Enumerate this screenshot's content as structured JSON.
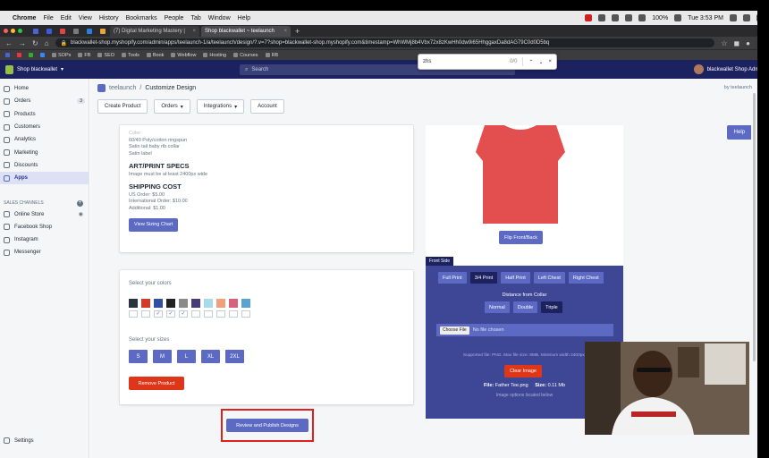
{
  "menubar": {
    "app": "Chrome",
    "items": [
      "File",
      "Edit",
      "View",
      "History",
      "Bookmarks",
      "People",
      "Tab",
      "Window",
      "Help"
    ],
    "battery": "100%",
    "clock": "Tue 3:53 PM"
  },
  "tabs": [
    {
      "label": "(7) Digital Marketing Mastery |",
      "active": false
    },
    {
      "label": "Shop blackwallet ~ teelaunch",
      "active": true
    }
  ],
  "address": {
    "url": "blackwallet-shop.myshopify.com/admin/apps/teelaunch-1/a/teelaunch/design/?.v=7?shop=blackwallet-shop.myshopify.com&timestamp=WhWMj8b4Vbx72x8zKwHh0dw9i65HhggaxDa8dAG79C0d0D5bq"
  },
  "bookmarks": [
    "SOPs",
    "FB",
    "SEO",
    "Tools",
    "Book",
    "Webflow",
    "Hosting",
    "Courses",
    "RB"
  ],
  "find": {
    "query": "zhs",
    "count": "0/0"
  },
  "shopbar": {
    "store": "Shop blackwallet",
    "search_placeholder": "Search",
    "admin": "blackwallet Shop Admin"
  },
  "sidebar": {
    "items": [
      {
        "label": "Home"
      },
      {
        "label": "Orders",
        "badge": "3"
      },
      {
        "label": "Products"
      },
      {
        "label": "Customers"
      },
      {
        "label": "Analytics"
      },
      {
        "label": "Marketing"
      },
      {
        "label": "Discounts"
      },
      {
        "label": "Apps"
      }
    ],
    "channels_label": "SALES CHANNELS",
    "channels": [
      {
        "label": "Online Store"
      },
      {
        "label": "Facebook Shop"
      },
      {
        "label": "Instagram"
      },
      {
        "label": "Messenger"
      }
    ],
    "settings": "Settings"
  },
  "header": {
    "app_name": "teelaunch",
    "separator": "/",
    "page_title": "Customize Design",
    "by": "by teelaunch"
  },
  "toolbar": {
    "create": "Create Product",
    "orders": "Orders",
    "integrations": "Integrations",
    "account": "Account",
    "help": "Help"
  },
  "specs": {
    "cut_line": "Color:",
    "lines": [
      "60/40 Poly/cotton ringspun",
      "Satin tail baby rib collar",
      "Satin label"
    ],
    "art_title": "ART/PRINT SPECS",
    "art_text": "Image must be at least 2400px wide",
    "ship_title": "SHIPPING COST",
    "ship_lines": [
      "US Order: $5.00",
      "International Order: $10.00",
      "Additional: $1.00"
    ],
    "sizing_button": "View Sizing Chart"
  },
  "colors": {
    "label": "Select your colors",
    "swatches": [
      "#2c3340",
      "#d23b2b",
      "#324fa0",
      "#222222",
      "#8a8a8a",
      "#4b3b77",
      "#a8dbe8",
      "#eea17a",
      "#d6637e",
      "#5aa3d0"
    ],
    "checked": [
      false,
      false,
      true,
      true,
      true,
      false,
      false,
      false,
      false,
      false
    ]
  },
  "sizes": {
    "label": "Select your sizes",
    "options": [
      "S",
      "M",
      "L",
      "XL",
      "2XL"
    ]
  },
  "remove_button": "Remove Product",
  "publish_button": "Review and Publish Designs",
  "preview": {
    "shirt_color": "#e34f4f",
    "flip_button": "Flip Front/Back"
  },
  "print_panel": {
    "side_label": "Front Side",
    "options": [
      "Full Print",
      "3/4 Print",
      "Half Print",
      "Left Chest",
      "Right Chest"
    ],
    "selected": 1,
    "distance_label": "Distance from Collar",
    "distance_options": [
      "Normal",
      "Double",
      "Triple"
    ],
    "distance_selected": 2,
    "choose_file": "Choose File",
    "no_file": "No file chosen",
    "note": "Supported file: PNG. Max file size: 8MB. Minimum width 2400px.",
    "clear_button": "Clear Image",
    "file_label": "File:",
    "file_value": "Father Tee.png",
    "size_label": "Size:",
    "size_value": "0.11 Mb",
    "image_options": "Image options located below"
  }
}
